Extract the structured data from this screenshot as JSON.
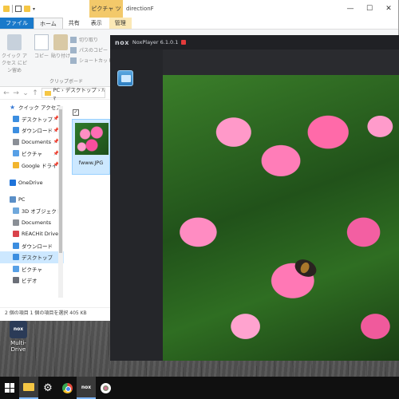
{
  "explorer": {
    "context_tab": "ピクチャ ツール",
    "window_title": "directionF",
    "window_controls": {
      "minimize": "—",
      "maximize": "☐",
      "close": "✕"
    },
    "tabs": [
      "ファイル",
      "ホーム",
      "共有",
      "表示"
    ],
    "manage_tab": "管理",
    "ribbon": {
      "pin_label": "クイック アクセス にピン留め",
      "copy_label": "コピー",
      "paste_label": "貼り付け",
      "cut_label": "切り取り",
      "copy_path_label": "パスのコピー",
      "paste_shortcut_label": "ショートカットの貼り付け",
      "group_label": "クリップボード"
    },
    "address": {
      "back": "←",
      "forward": "→",
      "down": "⌄",
      "up": "↑",
      "path": "PC › デスクトップ › ﾊﾏ"
    },
    "nav": [
      {
        "label": "クイック アクセス",
        "type": "star"
      },
      {
        "label": "デスクトップ",
        "type": "desktop",
        "pinned": true
      },
      {
        "label": "ダウンロード",
        "type": "download",
        "pinned": true
      },
      {
        "label": "Documents",
        "type": "doc",
        "pinned": true
      },
      {
        "label": "ピクチャ",
        "type": "pic",
        "pinned": true
      },
      {
        "label": "Google ドライブ",
        "type": "gdrive",
        "pinned": true
      },
      {
        "label": "OneDrive",
        "type": "onedrive"
      },
      {
        "label": "PC",
        "type": "pc"
      },
      {
        "label": "3D オブジェクト",
        "type": "obj3d"
      },
      {
        "label": "Documents",
        "type": "doc"
      },
      {
        "label": "REACHit Drive",
        "type": "reach"
      },
      {
        "label": "ダウンロード",
        "type": "download"
      },
      {
        "label": "デスクトップ",
        "type": "desktop",
        "selected": true
      },
      {
        "label": "ピクチャ",
        "type": "pic"
      },
      {
        "label": "ビデオ",
        "type": "video"
      }
    ],
    "pin_glyph": "📌",
    "file": {
      "name": "fwww.JPG",
      "checked": "✓"
    },
    "status": "2 個の項目   1 個の項目を選択  405 KB"
  },
  "nox": {
    "logo": "nox",
    "title": "NoxPlayer 6.1.0.1"
  },
  "desktop_icon": {
    "label": "Multi-Drive",
    "glyph": "nox"
  },
  "taskbar": {
    "gear": "⚙",
    "nox": "nox"
  },
  "colors": {
    "file_tab": "#1979ca",
    "context_tab": "#f3c96a",
    "selection": "#cde8ff",
    "nox_bg": "#2b2c30",
    "taskbar": "#101010"
  }
}
